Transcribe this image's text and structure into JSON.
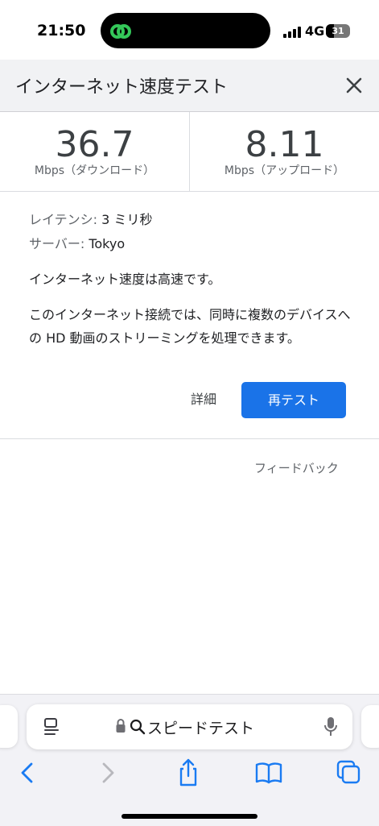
{
  "status_bar": {
    "time": "21:50",
    "network": "4G",
    "battery": "31"
  },
  "header": {
    "title": "インターネット速度テスト"
  },
  "results": {
    "download": {
      "value": "36.7",
      "unit": "Mbps（ダウンロード）"
    },
    "upload": {
      "value": "8.11",
      "unit": "Mbps（アップロード）"
    }
  },
  "details": {
    "latency_label": "レイテンシ: ",
    "latency_value": "3 ミリ秒",
    "server_label": "サーバー: ",
    "server_value": "Tokyo",
    "summary": "インターネット速度は高速です。",
    "description": "このインターネット接続では、同時に複数のデバイスへの HD 動画のストリーミングを処理できます。"
  },
  "actions": {
    "details_label": "詳細",
    "retest_label": "再テスト",
    "feedback_label": "フィードバック"
  },
  "browser": {
    "address_text": "スピードテスト"
  },
  "colors": {
    "accent": "#1a73e8",
    "header_bg": "#f1f2f4",
    "safari_blue": "#1a7bf2"
  },
  "icons": [
    "close-icon",
    "reader-icon",
    "lock-icon",
    "search-icon",
    "mic-icon",
    "back-icon",
    "forward-icon",
    "share-icon",
    "bookmarks-icon",
    "tabs-icon"
  ]
}
